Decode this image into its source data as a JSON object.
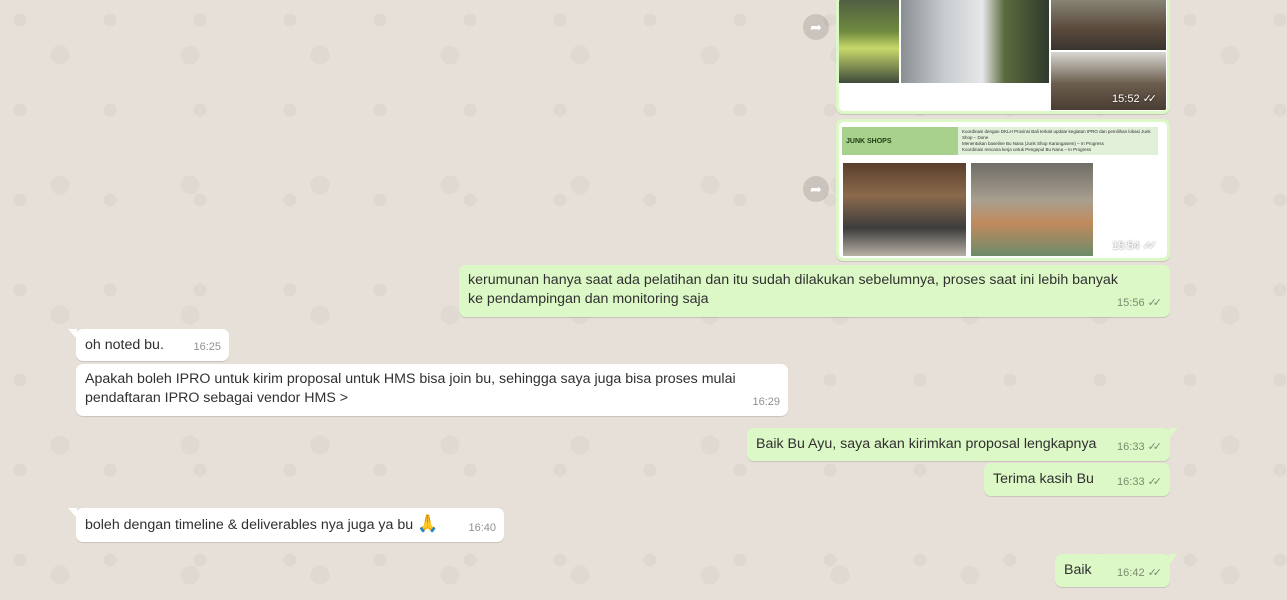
{
  "chat": {
    "messages": [
      {
        "id": "m1",
        "direction": "out",
        "type": "image-album",
        "time": "15:52",
        "status": "read"
      },
      {
        "id": "m2",
        "direction": "out",
        "type": "image-slide",
        "time": "15:54",
        "status": "read",
        "slide": {
          "heading": "JUNK SHOPS",
          "bullets": [
            "Koordinasi dengan DKLH Provinsi Bali terkait update kegiatan IPRO dan pemilihan lokasi Junk Shop – Done",
            "Menentukan baseline Bu Nana (Junk Shop Karangasem) – In Progress",
            "Koordinasi rencana kerja untuk Pengepul Bu Nana – In Progress"
          ]
        }
      },
      {
        "id": "m3",
        "direction": "out",
        "type": "text",
        "text": "kerumunan hanya saat ada pelatihan dan itu sudah dilakukan sebelumnya, proses saat ini lebih banyak ke pendampingan dan monitoring saja",
        "time": "15:56",
        "status": "read"
      },
      {
        "id": "m4",
        "direction": "in",
        "type": "text",
        "text": "oh noted bu.",
        "time": "16:25"
      },
      {
        "id": "m5",
        "direction": "in",
        "type": "text",
        "text": "Apakah boleh IPRO untuk kirim proposal untuk HMS bisa join bu, sehingga saya juga bisa proses mulai pendaftaran IPRO sebagai vendor HMS >",
        "time": "16:29"
      },
      {
        "id": "m6",
        "direction": "out",
        "type": "text",
        "text": "Baik Bu Ayu, saya akan kirimkan proposal lengkapnya",
        "time": "16:33",
        "status": "read"
      },
      {
        "id": "m7",
        "direction": "out",
        "type": "text",
        "text": "Terima kasih Bu",
        "time": "16:33",
        "status": "read"
      },
      {
        "id": "m8",
        "direction": "in",
        "type": "text",
        "text": "boleh dengan timeline & deliverables nya juga ya bu",
        "emoji": "🙏",
        "time": "16:40"
      },
      {
        "id": "m9",
        "direction": "out",
        "type": "text",
        "text": "Baik",
        "time": "16:42",
        "status": "read"
      }
    ],
    "icons": {
      "forward": "forward-arrow-icon",
      "ticks": "double-check-icon"
    },
    "colors": {
      "incoming": "#ffffff",
      "outgoing": "#dcf8c6",
      "background": "#e7e0d8"
    }
  }
}
